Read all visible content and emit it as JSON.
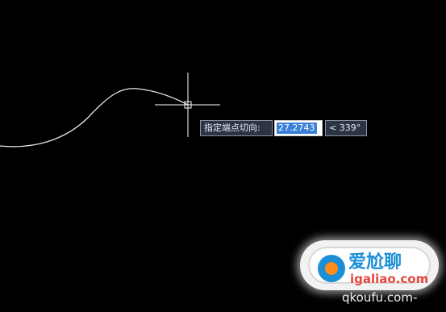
{
  "command_line": {
    "prompt_text": "指定端点切向:",
    "value_text": "27.2743",
    "angle_text": "< 339°"
  },
  "watermark": {
    "title": "爱尬聊",
    "url": "igaliao.com",
    "url2": "qkoufu.com-"
  },
  "colors": {
    "canvas_background": "#000000",
    "geometry_stroke": "#e6e6e6",
    "crosshair": "#ffffff",
    "prompt_background": "#2b3344",
    "selection_highlight": "#3a7fd9"
  }
}
